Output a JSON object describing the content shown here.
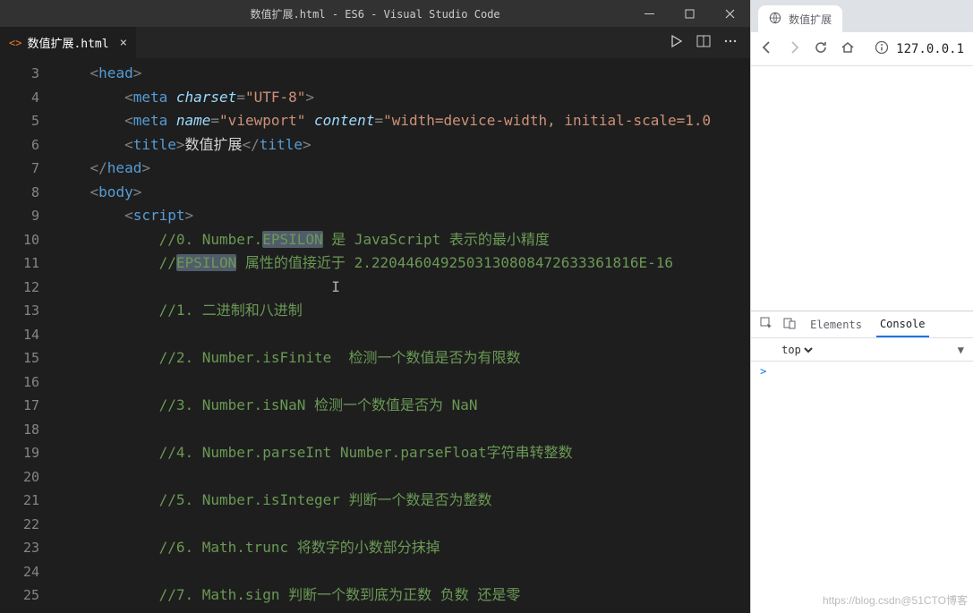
{
  "vscode": {
    "title": "数值扩展.html - ES6 - Visual Studio Code",
    "tab": {
      "filename": "数值扩展.html"
    },
    "lineStart": 3,
    "lineCount": 23,
    "code": [
      {
        "indent": 1,
        "tokens": [
          [
            "pun",
            "<"
          ],
          [
            "tag",
            "head"
          ],
          [
            "pun",
            ">"
          ]
        ]
      },
      {
        "indent": 2,
        "tokens": [
          [
            "pun",
            "<"
          ],
          [
            "tag",
            "meta"
          ],
          [
            "txt",
            " "
          ],
          [
            "attr",
            "charset"
          ],
          [
            "pun",
            "="
          ],
          [
            "str",
            "\"UTF-8\""
          ],
          [
            "pun",
            ">"
          ]
        ]
      },
      {
        "indent": 2,
        "tokens": [
          [
            "pun",
            "<"
          ],
          [
            "tag",
            "meta"
          ],
          [
            "txt",
            " "
          ],
          [
            "attr",
            "name"
          ],
          [
            "pun",
            "="
          ],
          [
            "str",
            "\"viewport\""
          ],
          [
            "txt",
            " "
          ],
          [
            "attr",
            "content"
          ],
          [
            "pun",
            "="
          ],
          [
            "str",
            "\"width=device-width, initial-scale=1.0"
          ]
        ]
      },
      {
        "indent": 2,
        "tokens": [
          [
            "pun",
            "<"
          ],
          [
            "tag",
            "title"
          ],
          [
            "pun",
            ">"
          ],
          [
            "txt",
            "数值扩展"
          ],
          [
            "pun",
            "</"
          ],
          [
            "tag",
            "title"
          ],
          [
            "pun",
            ">"
          ]
        ]
      },
      {
        "indent": 1,
        "tokens": [
          [
            "pun",
            "</"
          ],
          [
            "tag",
            "head"
          ],
          [
            "pun",
            ">"
          ]
        ]
      },
      {
        "indent": 1,
        "tokens": [
          [
            "pun",
            "<"
          ],
          [
            "tag",
            "body"
          ],
          [
            "pun",
            ">"
          ]
        ]
      },
      {
        "indent": 2,
        "tokens": [
          [
            "pun",
            "<"
          ],
          [
            "tag",
            "script"
          ],
          [
            "pun",
            ">"
          ]
        ]
      },
      {
        "indent": 3,
        "tokens": [
          [
            "cmt",
            "//0. Number."
          ],
          [
            "cmthl",
            "EPSILON"
          ],
          [
            "cmt",
            " 是 JavaScript 表示的最小精度"
          ]
        ]
      },
      {
        "indent": 3,
        "tokens": [
          [
            "cmt",
            "//"
          ],
          [
            "cmthl",
            "EPSILON"
          ],
          [
            "cmt",
            " 属性的值接近于 2.2204460492503130808472633361816E-16"
          ]
        ]
      },
      {
        "indent": 3,
        "tokens": [
          [
            "cursor",
            "                    I"
          ]
        ]
      },
      {
        "indent": 3,
        "tokens": [
          [
            "cmt",
            "//1. 二进制和八进制"
          ]
        ]
      },
      {
        "indent": 3,
        "tokens": []
      },
      {
        "indent": 3,
        "tokens": [
          [
            "cmt",
            "//2. Number.isFinite  检测一个数值是否为有限数"
          ]
        ]
      },
      {
        "indent": 3,
        "tokens": []
      },
      {
        "indent": 3,
        "tokens": [
          [
            "cmt",
            "//3. Number.isNaN 检测一个数值是否为 NaN"
          ]
        ]
      },
      {
        "indent": 3,
        "tokens": []
      },
      {
        "indent": 3,
        "tokens": [
          [
            "cmt",
            "//4. Number.parseInt Number.parseFloat字符串转整数"
          ]
        ]
      },
      {
        "indent": 3,
        "tokens": []
      },
      {
        "indent": 3,
        "tokens": [
          [
            "cmt",
            "//5. Number.isInteger 判断一个数是否为整数"
          ]
        ]
      },
      {
        "indent": 3,
        "tokens": []
      },
      {
        "indent": 3,
        "tokens": [
          [
            "cmt",
            "//6. Math.trunc 将数字的小数部分抹掉"
          ]
        ]
      },
      {
        "indent": 3,
        "tokens": []
      },
      {
        "indent": 3,
        "tokens": [
          [
            "cmt",
            "//7. Math.sign 判断一个数到底为正数 负数 还是零"
          ]
        ]
      }
    ]
  },
  "browser": {
    "tabTitle": "数值扩展",
    "url": "127.0.0.1",
    "devtools": {
      "tabs": {
        "elements": "Elements",
        "console": "Console"
      },
      "context": "top",
      "prompt": ">"
    }
  },
  "watermark": "https://blog.csdn@51CTO博客"
}
